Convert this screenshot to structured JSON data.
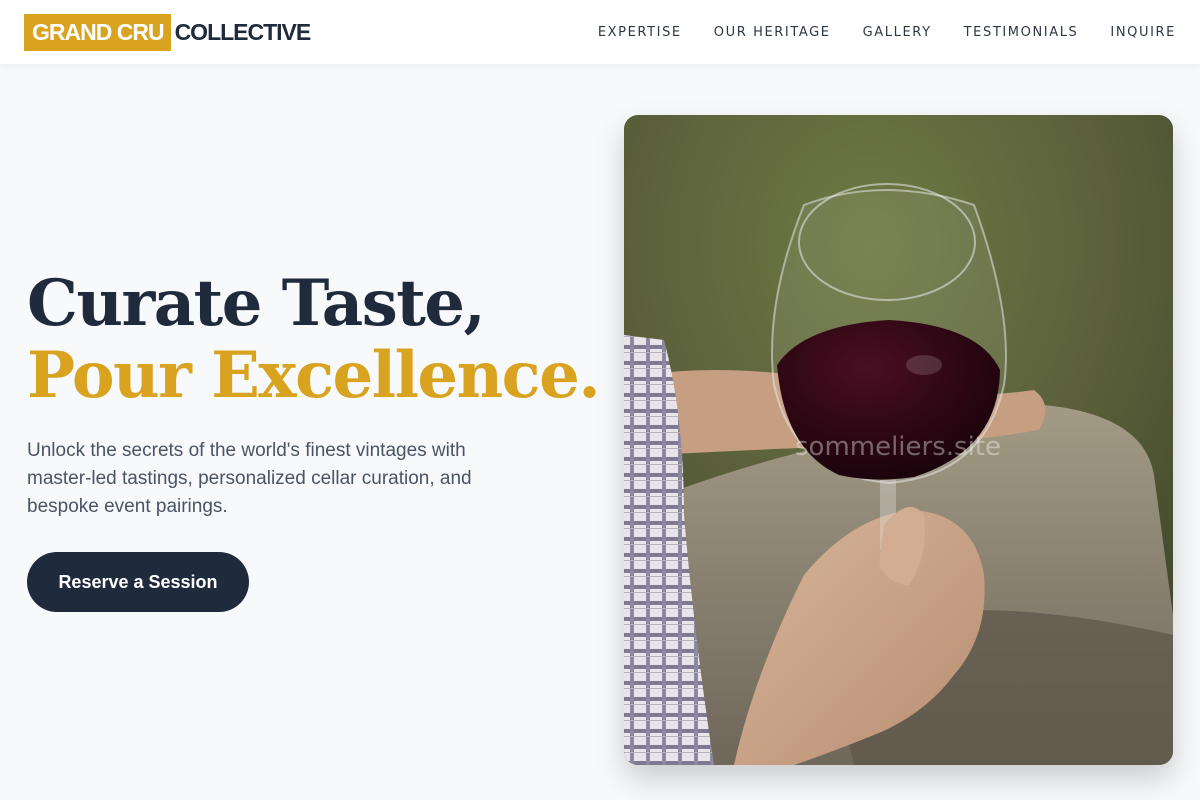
{
  "header": {
    "logo_mark": "GRAND CRU",
    "logo_text": "COLLECTIVE",
    "nav": [
      "EXPERTISE",
      "OUR HERITAGE",
      "GALLERY",
      "TESTIMONIALS",
      "INQUIRE"
    ]
  },
  "hero": {
    "title_line1": "Curate Taste,",
    "title_line2": "Pour Excellence.",
    "subtitle": "Unlock the secrets of the world's finest vintages with master-led tastings, personalized cellar curation, and bespoke event pairings.",
    "cta_label": "Reserve a Session"
  },
  "image": {
    "watermark": "sommeliers.site"
  },
  "colors": {
    "accent": "#d9a21f",
    "navy": "#1f2a3d",
    "background": "#f7f9fb"
  }
}
